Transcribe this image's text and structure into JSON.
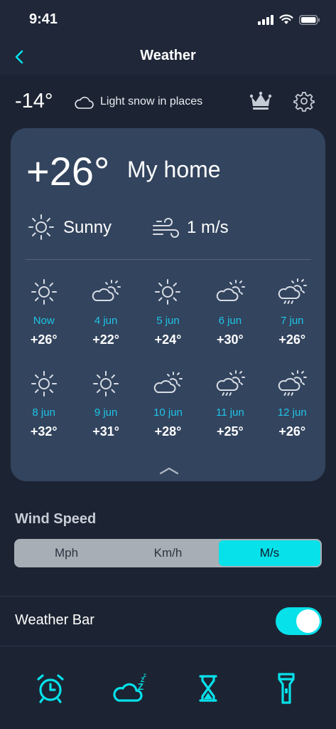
{
  "status": {
    "time": "9:41"
  },
  "nav": {
    "title": "Weather"
  },
  "current": {
    "temp": "-14°",
    "description": "Light snow in places"
  },
  "card": {
    "temp": "+26°",
    "location": "My home",
    "condition": "Sunny",
    "wind": "1 m/s"
  },
  "forecast": [
    {
      "date": "Now",
      "temp": "+26°",
      "icon": "sun-icon"
    },
    {
      "date": "4 jun",
      "temp": "+22°",
      "icon": "partly-cloudy-icon"
    },
    {
      "date": "5 jun",
      "temp": "+24°",
      "icon": "sun-icon"
    },
    {
      "date": "6 jun",
      "temp": "+30°",
      "icon": "partly-cloudy-icon"
    },
    {
      "date": "7 jun",
      "temp": "+26°",
      "icon": "rain-sun-icon"
    },
    {
      "date": "8 jun",
      "temp": "+32°",
      "icon": "sun-icon"
    },
    {
      "date": "9 jun",
      "temp": "+31°",
      "icon": "sun-icon"
    },
    {
      "date": "10 jun",
      "temp": "+28°",
      "icon": "partly-cloudy-icon"
    },
    {
      "date": "11 jun",
      "temp": "+25°",
      "icon": "rain-sun-icon"
    },
    {
      "date": "12 jun",
      "temp": "+26°",
      "icon": "rain-sun-icon"
    }
  ],
  "settings": {
    "wind_speed_label": "Wind Speed",
    "units": [
      "Mph",
      "Km/h",
      "M/s"
    ],
    "selected_unit": "M/s",
    "weather_bar_label": "Weather Bar",
    "weather_bar_on": true
  },
  "tabs": [
    "alarm-clock-icon",
    "sleep-cloud-icon",
    "hourglass-icon",
    "flashlight-icon"
  ],
  "colors": {
    "accent": "#07e1ea",
    "date_text": "#1fc4e6",
    "card": "#33445e",
    "background": "#1c2433"
  }
}
